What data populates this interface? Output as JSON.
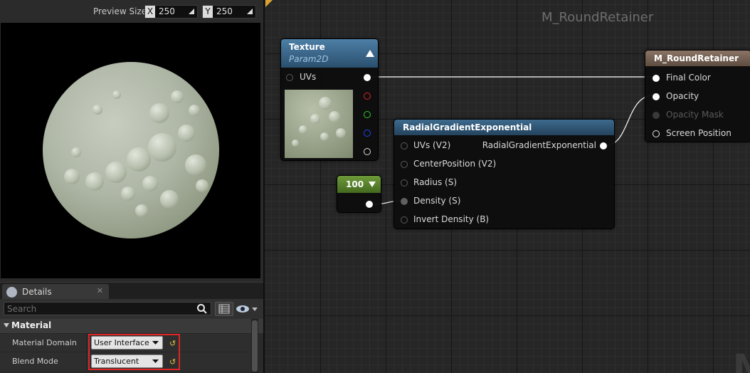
{
  "preview": {
    "size_label": "Preview Size",
    "x_axis": "X",
    "x_value": "250",
    "y_axis": "Y",
    "y_value": "250"
  },
  "details": {
    "tab_label": "Details",
    "tab_close": "✕",
    "search_placeholder": "Search",
    "section_label": "Material",
    "properties": [
      {
        "name": "Material Domain",
        "value": "User Interface"
      },
      {
        "name": "Blend Mode",
        "value": "Translucent"
      }
    ]
  },
  "graph": {
    "title": "M_RoundRetainer",
    "watermark": "M",
    "nodes": {
      "texture": {
        "title": "Texture",
        "subtitle": "Param2D",
        "input_pin": "UVs",
        "output_colors": [
          "#ffffff",
          "#d92626",
          "#2ecc2e",
          "#2244ee",
          "#ffffff"
        ]
      },
      "constant": {
        "value": "100"
      },
      "radial": {
        "title": "RadialGradientExponential",
        "inputs": [
          "UVs (V2)",
          "CenterPosition (V2)",
          "Radius (S)",
          "Density (S)",
          "Invert Density (B)"
        ],
        "output": "RadialGradientExponential"
      },
      "result": {
        "title": "M_RoundRetainer",
        "pins": [
          "Final Color",
          "Opacity",
          "Opacity Mask",
          "Screen Position"
        ]
      }
    }
  }
}
